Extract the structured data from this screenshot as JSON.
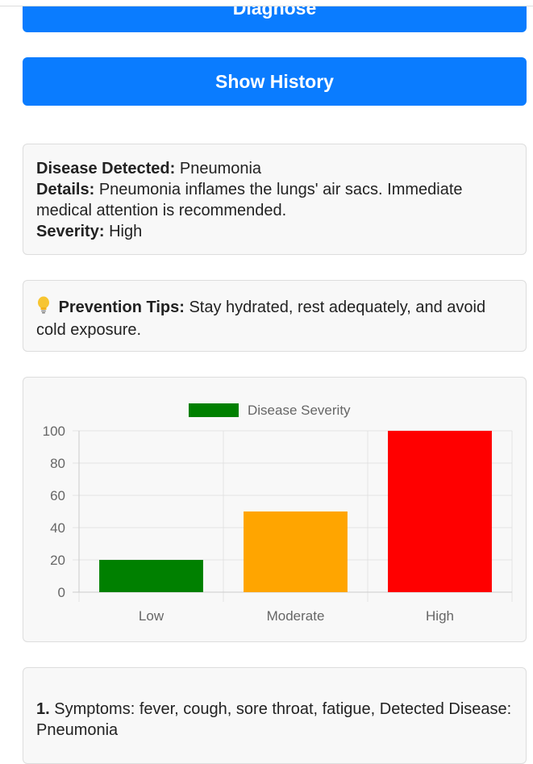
{
  "buttons": {
    "diagnose_label": "Diagnose",
    "history_label": "Show History"
  },
  "result": {
    "disease_label": "Disease Detected:",
    "disease_value": "Pneumonia",
    "details_label": "Details:",
    "details_value": "Pneumonia inflames the lungs' air sacs. Immediate medical attention is recommended.",
    "severity_label": "Severity:",
    "severity_value": "High"
  },
  "tips": {
    "icon": "lightbulb-icon",
    "label": "Prevention Tips:",
    "text": "Stay hydrated, rest adequately, and avoid cold exposure."
  },
  "chart_data": {
    "type": "bar",
    "categories": [
      "Low",
      "Moderate",
      "High"
    ],
    "values": [
      20,
      50,
      100
    ],
    "colors": [
      "#008000",
      "#ffa500",
      "#ff0000"
    ],
    "legend_label": "Disease Severity",
    "legend_color": "#008000",
    "legend_position": "top",
    "ylim": [
      0,
      100
    ],
    "yticks": [
      "100",
      "80",
      "60",
      "40",
      "20",
      "0"
    ],
    "grid": true
  },
  "history": {
    "items": [
      {
        "number": "1.",
        "text": "Symptoms: fever, cough, sore throat, fatigue, Detected Disease: Pneumonia"
      }
    ]
  },
  "colors": {
    "accent": "#0a7cff",
    "card_bg": "#f8f8f8"
  }
}
